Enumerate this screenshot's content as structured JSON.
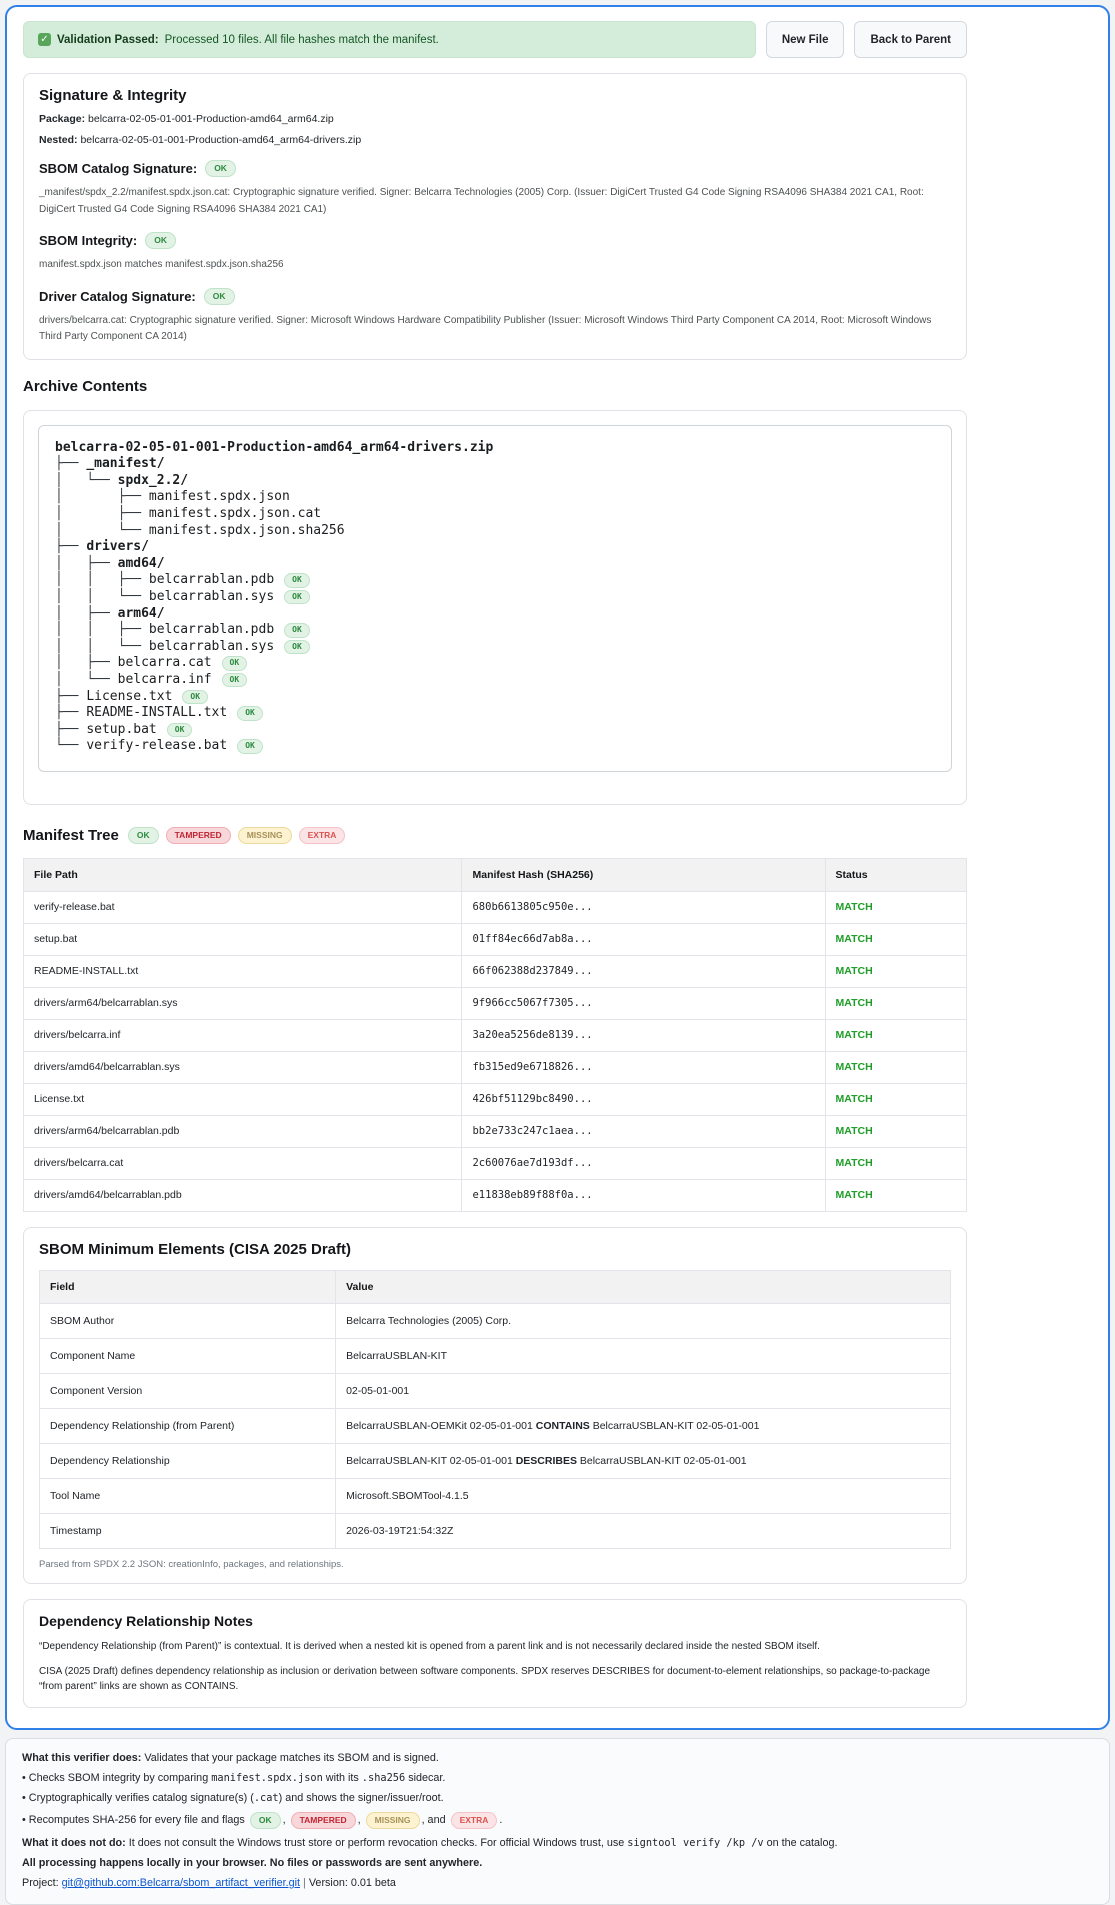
{
  "banner": {
    "icon": "✓",
    "title": "Validation Passed:",
    "text": "Processed 10 files. All file hashes match the manifest."
  },
  "toolbar": {
    "new_file": "New File",
    "back_to_parent": "Back to Parent"
  },
  "signature": {
    "heading": "Signature & Integrity",
    "package_label": "Package:",
    "package": "belcarra-02-05-01-001-Production-amd64_arm64.zip",
    "nested_label": "Nested:",
    "nested": "belcarra-02-05-01-001-Production-amd64_arm64-drivers.zip",
    "items": [
      {
        "label": "SBOM Catalog Signature:",
        "badge": "OK",
        "detail": "_manifest/spdx_2.2/manifest.spdx.json.cat: Cryptographic signature verified. Signer: Belcarra Technologies (2005) Corp. (Issuer: DigiCert Trusted G4 Code Signing RSA4096 SHA384 2021 CA1, Root: DigiCert Trusted G4 Code Signing RSA4096 SHA384 2021 CA1)"
      },
      {
        "label": "SBOM Integrity:",
        "badge": "OK",
        "detail": "manifest.spdx.json matches manifest.spdx.json.sha256"
      },
      {
        "label": "Driver Catalog Signature:",
        "badge": "OK",
        "detail": "drivers/belcarra.cat: Cryptographic signature verified. Signer: Microsoft Windows Hardware Compatibility Publisher (Issuer: Microsoft Windows Third Party Component CA 2014, Root: Microsoft Windows Third Party Component CA 2014)"
      }
    ]
  },
  "archive": {
    "heading": "Archive Contents",
    "tree": [
      {
        "prefix": "",
        "name": "belcarra-02-05-01-001-Production-amd64_arm64-drivers.zip",
        "bold": true
      },
      {
        "prefix": "├── ",
        "name": "_manifest/",
        "bold": true
      },
      {
        "prefix": "│   └── ",
        "name": "spdx_2.2/",
        "bold": true
      },
      {
        "prefix": "│       ├── ",
        "name": "manifest.spdx.json"
      },
      {
        "prefix": "│       ├── ",
        "name": "manifest.spdx.json.cat"
      },
      {
        "prefix": "│       └── ",
        "name": "manifest.spdx.json.sha256"
      },
      {
        "prefix": "├── ",
        "name": "drivers/",
        "bold": true
      },
      {
        "prefix": "│   ├── ",
        "name": "amd64/",
        "bold": true
      },
      {
        "prefix": "│   │   ├── ",
        "name": "belcarrablan.pdb",
        "ok": "OK"
      },
      {
        "prefix": "│   │   └── ",
        "name": "belcarrablan.sys",
        "ok": "OK"
      },
      {
        "prefix": "│   ├── ",
        "name": "arm64/",
        "bold": true
      },
      {
        "prefix": "│   │   ├── ",
        "name": "belcarrablan.pdb",
        "ok": "OK"
      },
      {
        "prefix": "│   │   └── ",
        "name": "belcarrablan.sys",
        "ok": "OK"
      },
      {
        "prefix": "│   ├── ",
        "name": "belcarra.cat",
        "ok": "OK"
      },
      {
        "prefix": "│   └── ",
        "name": "belcarra.inf",
        "ok": "OK"
      },
      {
        "prefix": "├── ",
        "name": "License.txt",
        "ok": "OK"
      },
      {
        "prefix": "├── ",
        "name": "README-INSTALL.txt",
        "ok": "OK"
      },
      {
        "prefix": "├── ",
        "name": "setup.bat",
        "ok": "OK"
      },
      {
        "prefix": "└── ",
        "name": "verify-release.bat",
        "ok": "OK"
      }
    ]
  },
  "manifest": {
    "heading": "Manifest Tree",
    "legend": [
      {
        "label": "OK",
        "cls": "b-ok"
      },
      {
        "label": "TAMPERED",
        "cls": "b-tampered"
      },
      {
        "label": "MISSING",
        "cls": "b-missing"
      },
      {
        "label": "EXTRA",
        "cls": "b-extra"
      }
    ],
    "columns": [
      "File Path",
      "Manifest Hash (SHA256)",
      "Status"
    ],
    "rows": [
      {
        "path": "verify-release.bat",
        "hash": "680b6613805c950e...",
        "status": "MATCH"
      },
      {
        "path": "setup.bat",
        "hash": "01ff84ec66d7ab8a...",
        "status": "MATCH"
      },
      {
        "path": "README-INSTALL.txt",
        "hash": "66f062388d237849...",
        "status": "MATCH"
      },
      {
        "path": "drivers/arm64/belcarrablan.sys",
        "hash": "9f966cc5067f7305...",
        "status": "MATCH"
      },
      {
        "path": "drivers/belcarra.inf",
        "hash": "3a20ea5256de8139...",
        "status": "MATCH"
      },
      {
        "path": "drivers/amd64/belcarrablan.sys",
        "hash": "fb315ed9e6718826...",
        "status": "MATCH"
      },
      {
        "path": "License.txt",
        "hash": "426bf51129bc8490...",
        "status": "MATCH"
      },
      {
        "path": "drivers/arm64/belcarrablan.pdb",
        "hash": "bb2e733c247c1aea...",
        "status": "MATCH"
      },
      {
        "path": "drivers/belcarra.cat",
        "hash": "2c60076ae7d193df...",
        "status": "MATCH"
      },
      {
        "path": "drivers/amd64/belcarrablan.pdb",
        "hash": "e11838eb89f88f0a...",
        "status": "MATCH"
      }
    ]
  },
  "sbom": {
    "heading": "SBOM Minimum Elements (CISA 2025 Draft)",
    "columns": [
      "Field",
      "Value"
    ],
    "rows": [
      {
        "field": "SBOM Author",
        "pre": "Belcarra Technologies (2005) Corp."
      },
      {
        "field": "Component Name",
        "pre": "BelcarraUSBLAN-KIT"
      },
      {
        "field": "Component Version",
        "pre": "02-05-01-001"
      },
      {
        "field": "Dependency Relationship (from Parent)",
        "pre": "BelcarraUSBLAN-OEMKit 02-05-01-001 ",
        "bold": "CONTAINS",
        "post": " BelcarraUSBLAN-KIT 02-05-01-001"
      },
      {
        "field": "Dependency Relationship",
        "pre": "BelcarraUSBLAN-KIT 02-05-01-001 ",
        "bold": "DESCRIBES",
        "post": " BelcarraUSBLAN-KIT 02-05-01-001"
      },
      {
        "field": "Tool Name",
        "pre": "Microsoft.SBOMTool-4.1.5"
      },
      {
        "field": "Timestamp",
        "pre": "2026-03-19T21:54:32Z"
      }
    ],
    "footnote": "Parsed from SPDX 2.2 JSON: creationInfo, packages, and relationships."
  },
  "notes": {
    "heading": "Dependency Relationship Notes",
    "paragraphs": [
      "“Dependency Relationship (from Parent)” is contextual. It is derived when a nested kit is opened from a parent link and is not necessarily declared inside the nested SBOM itself.",
      "CISA (2025 Draft) defines dependency relationship as inclusion or derivation between software components. SPDX reserves DESCRIBES for document-to-element relationships, so package-to-package “from parent” links are shown as CONTAINS."
    ]
  },
  "footer": {
    "does": {
      "label": "What this verifier does:",
      "text": "Validates that your package matches its SBOM and is signed."
    },
    "b1": {
      "pre": "• Checks SBOM integrity by comparing ",
      "c1": "manifest.spdx.json",
      "mid": " with its ",
      "c2": ".sha256",
      "post": " sidecar."
    },
    "b2": {
      "pre": "• Cryptographically verifies catalog signature(s) (",
      "c1": ".cat",
      "post": ") and shows the signer/issuer/root."
    },
    "b3": {
      "pre": "• Recomputes SHA-256 for every file and flags",
      "ok": "OK",
      "s1": ",",
      "tampered": "TAMPERED",
      "s2": ",",
      "missing": "MISSING",
      "s3": ", and",
      "extra": "EXTRA",
      "end": "."
    },
    "not": {
      "label": "What it does not do:",
      "text": "It does not consult the Windows trust store or perform revocation checks. For official Windows trust, use",
      "code": "signtool verify /kp /v",
      "post": "on the catalog."
    },
    "local": "All processing happens locally in your browser. No files or passwords are sent anywhere.",
    "project": {
      "label": "Project:",
      "link": "git@github.com:Belcarra/sbom_artifact_verifier.git",
      "sep": "|",
      "version": "Version: 0.01 beta"
    }
  }
}
